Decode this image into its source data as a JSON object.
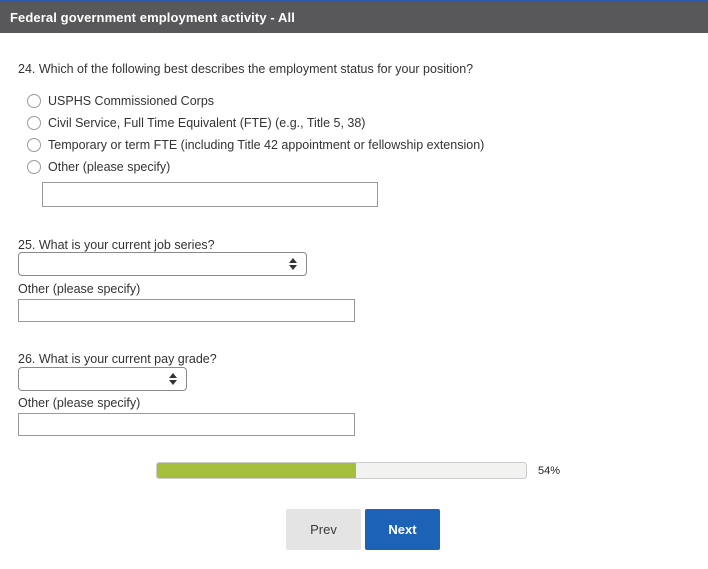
{
  "header": {
    "title": "Federal government employment activity - All"
  },
  "questions": {
    "q24": {
      "label": "24. Which of the following best describes the employment status for your position?",
      "options": [
        "USPHS Commissioned Corps",
        "Civil Service, Full Time Equivalent (FTE) (e.g., Title 5, 38)",
        "Temporary or term FTE (including Title 42 appointment or fellowship extension)",
        "Other (please specify)"
      ],
      "other_value": ""
    },
    "q25": {
      "label": "25. What is your current job series?",
      "select_value": "",
      "other_label": "Other (please specify)",
      "other_value": ""
    },
    "q26": {
      "label": "26. What is your current pay grade?",
      "select_value": "",
      "other_label": "Other (please specify)",
      "other_value": ""
    }
  },
  "progress": {
    "percent": 54,
    "label": "54%"
  },
  "buttons": {
    "prev": "Prev",
    "next": "Next"
  },
  "colors": {
    "top_line_blue": "#2b5baa",
    "header_gray": "#58575a",
    "progress_green": "#a5bf3d",
    "next_blue": "#1c63b7"
  }
}
